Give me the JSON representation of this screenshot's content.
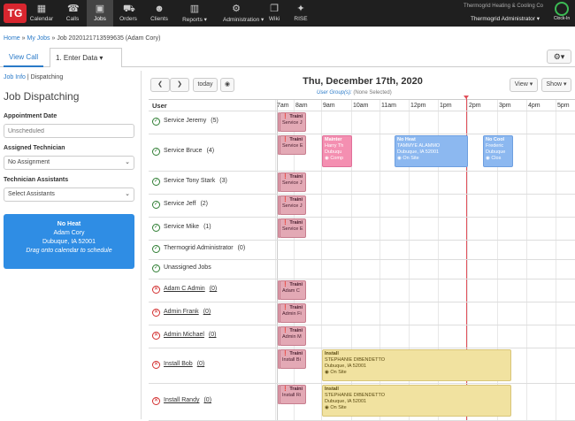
{
  "nav": {
    "logo": "TG",
    "items": [
      {
        "label": "Calendar",
        "icon": "calendar-icon",
        "glyph": "▦"
      },
      {
        "label": "Calls",
        "icon": "phone-icon",
        "glyph": "☎"
      },
      {
        "label": "Jobs",
        "icon": "briefcase-icon",
        "glyph": "▣"
      },
      {
        "label": "Orders",
        "icon": "truck-icon",
        "glyph": "⛟"
      },
      {
        "label": "Clients",
        "icon": "users-icon",
        "glyph": "☻"
      },
      {
        "label": "Reports ▾",
        "icon": "bar-chart-icon",
        "glyph": "▥"
      },
      {
        "label": "Administration ▾",
        "icon": "gear-icon",
        "glyph": "⚙"
      },
      {
        "label": "Wiki",
        "icon": "book-icon",
        "glyph": "❐"
      },
      {
        "label": "RISE",
        "icon": "rise-icon",
        "glyph": "✦"
      }
    ],
    "company": "Thermogrid Heating & Cooling Co",
    "user": "Thermogrid Administrator ▾",
    "clock_label": "Clock-In"
  },
  "breadcrumb": {
    "home": "Home",
    "sep1": " » ",
    "myjobs": "My Jobs",
    "rest": " » Job 2020121713599635 (Adam Cory)"
  },
  "tabs": {
    "view_call": "View Call",
    "enter_data": "1. Enter Data",
    "enter_caret": "▾",
    "gear": "⚙▾"
  },
  "left": {
    "job_info": "Job Info",
    "sep": " | ",
    "dispatching_link": "Dispatching",
    "title": "Job Dispatching",
    "appt_label": "Appointment Date",
    "appt_placeholder": "Unscheduled",
    "tech_label": "Assigned Technician",
    "tech_value": "No Assignment",
    "assist_label": "Technician Assistants",
    "assist_value": "Select Assistants",
    "card": {
      "title": "No Heat",
      "name": "Adam Cory",
      "city": "Dubuque, IA 52001",
      "hint": "Drag onto calendar to schedule"
    }
  },
  "calendar": {
    "prev": "❮",
    "next": "❯",
    "today": "today",
    "globe": "◉",
    "title": "Thu, December 17th, 2020",
    "usergroup_label": "User Group(s):",
    "usergroup_value": " (None Selected)",
    "view_btn": "View ▾",
    "show_btn": "Show ▾",
    "user_header": "User",
    "hours": [
      "7am",
      "8am",
      "9am",
      "10am",
      "11am",
      "12pm",
      "1pm",
      "2pm",
      "3pm",
      "4pm",
      "5pm"
    ],
    "rows": [
      {
        "name": "Service Jeremy",
        "count": "(5)",
        "status": "ok"
      },
      {
        "name": "Service Bruce",
        "count": "(4)",
        "status": "ok"
      },
      {
        "name": "Service Tony Stark",
        "count": "(3)",
        "status": "ok"
      },
      {
        "name": "Service Jeff",
        "count": "(2)",
        "status": "ok"
      },
      {
        "name": "Service Mike",
        "count": "(1)",
        "status": "ok"
      },
      {
        "name": "Thermogrid Administrator",
        "count": "(0)",
        "status": "ok"
      },
      {
        "name": "Unassigned Jobs",
        "count": "",
        "status": "ok"
      },
      {
        "name": "Adam C Admin",
        "count": "(0)",
        "status": "bad"
      },
      {
        "name": "Admin Frank",
        "count": "(0)",
        "status": "bad"
      },
      {
        "name": "Admin Michael",
        "count": "(0)",
        "status": "bad"
      },
      {
        "name": "Install Bob",
        "count": "(0)",
        "status": "bad"
      },
      {
        "name": "Install Randy",
        "count": "(0)",
        "status": "bad"
      }
    ],
    "training": {
      "title": "❗ Traini",
      "subs": [
        "Service J",
        "Service E",
        "Service J",
        "Service J",
        "Service E",
        "Adam C",
        "Admin Fi",
        "Admin M",
        "Install Bi",
        "Install Ri"
      ]
    },
    "events": {
      "maint": {
        "title": "Mainter",
        "l1": "Harry Th",
        "l2": "Dubuqu",
        "l3": "◉ Comp"
      },
      "noheat": {
        "title": "No Heat",
        "l1": "TAMMYE ALAMMO",
        "l2": "Dubuque, IA 52001",
        "l3": "◉ On Site"
      },
      "nocool": {
        "title": "No Cool",
        "l1": "Frederic",
        "l2": "Dubuque",
        "l3": "◉ Clos"
      },
      "install1": {
        "title": "Install",
        "l1": "STEPHANIE DIBENDETTO",
        "l2": "Dubuque, IA 52001",
        "l3": "◉ On Site"
      },
      "install2": {
        "title": "Install",
        "l1": "STEPHANIE DIBENDETTO",
        "l2": "Dubuque, IA 52001",
        "l3": "◉ On Site"
      }
    }
  }
}
